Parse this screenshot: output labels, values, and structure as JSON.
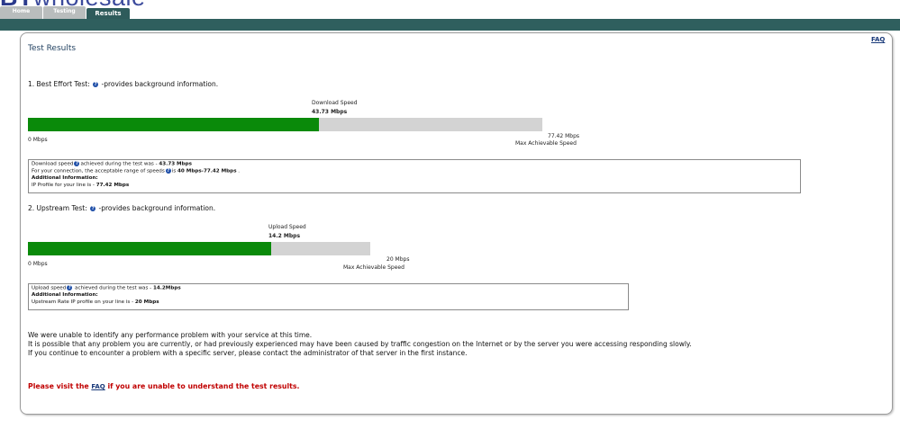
{
  "logo": {
    "brand": "BT",
    "text": "wholesale"
  },
  "tabs": [
    {
      "label": "Home"
    },
    {
      "label": "Testing"
    },
    {
      "label": "Results"
    }
  ],
  "faq": "FAQ",
  "page_title": "Test Results",
  "download": {
    "heading_prefix": "1. Best Effort Test:",
    "heading_suffix": "-provides background information.",
    "speed_label": "Download Speed",
    "speed_value": "43.73 Mbps",
    "min_label": "0 Mbps",
    "max_value": "77.42 Mbps",
    "max_label": "Max Achievable Speed",
    "fill_fraction": 0.5648,
    "info": {
      "line1_prefix": "Download speed",
      "line1_mid": "achieved during the test was - ",
      "line1_value": "43.73 Mbps",
      "line2_prefix": "For your connection, the acceptable range of speeds",
      "line2_mid": "is ",
      "line2_value": "40 Mbps-77.42 Mbps",
      "line2_suffix": " .",
      "additional": "Additional Information:",
      "line4_prefix": "IP Profile for your line is - ",
      "line4_value": "77.42 Mbps"
    }
  },
  "upload": {
    "heading_prefix": "2. Upstream Test:",
    "heading_suffix": "-provides background information.",
    "speed_label": "Upload Speed",
    "speed_value": "14.2 Mbps",
    "min_label": "0 Mbps",
    "max_value": "20 Mbps",
    "max_label": "Max Achievable Speed",
    "fill_fraction": 0.71,
    "info": {
      "line1_prefix": "Upload speed",
      "line1_mid": " achieved during the test was - ",
      "line1_value": "14.2Mbps",
      "additional": "Additional Information:",
      "line3_prefix": "Upstream Rate IP profile on your line is - ",
      "line3_value": "20 Mbps"
    }
  },
  "messages": [
    "We were unable to identify any performance problem with your service at this time.",
    "It is possible that any problem you are currently, or had previously experienced may have been caused by traffic congestion on the Internet or by the server you were accessing responding slowly.",
    "If you continue to encounter a problem with a specific server, please contact the administrator of that server in the first instance."
  ],
  "red_note": {
    "prefix": "Please visit the ",
    "link": "FAQ",
    "suffix": " if you are unable to understand the test results."
  },
  "colors": {
    "bar_fill": "#0a8a0a",
    "bar_track": "#d3d3d3",
    "topbar": "#2f5f5e",
    "warning": "#c00000"
  }
}
